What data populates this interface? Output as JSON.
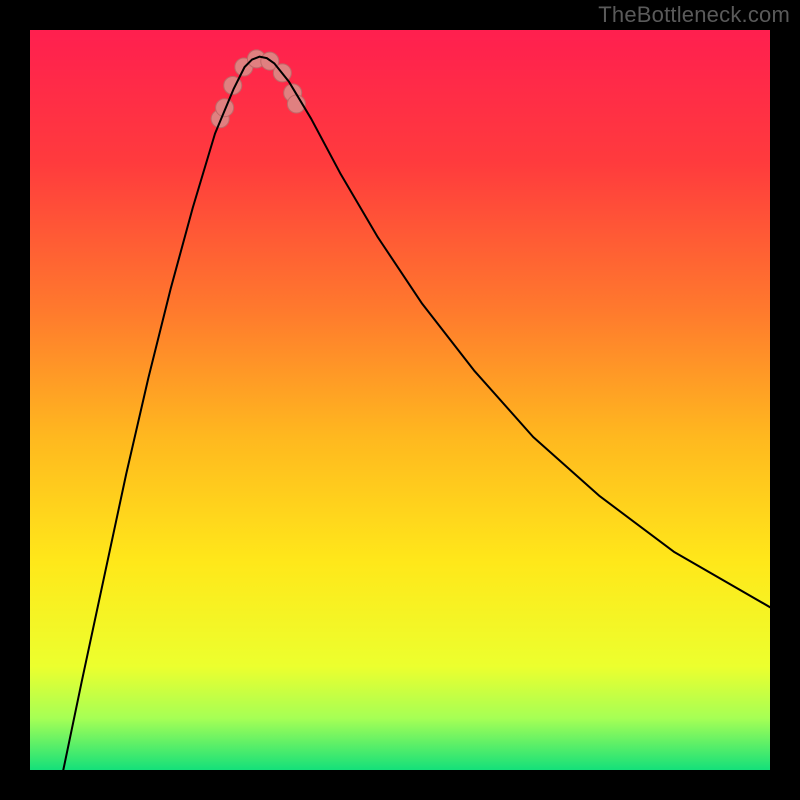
{
  "attribution": "TheBottleneck.com",
  "chart_data": {
    "type": "line",
    "title": "",
    "xlabel": "",
    "ylabel": "",
    "xlim": [
      0,
      100
    ],
    "ylim": [
      0,
      100
    ],
    "background_gradient_stops": [
      {
        "offset": 0,
        "color": "#ff1f4f"
      },
      {
        "offset": 18,
        "color": "#ff3b3d"
      },
      {
        "offset": 38,
        "color": "#ff7a2d"
      },
      {
        "offset": 55,
        "color": "#ffb81f"
      },
      {
        "offset": 72,
        "color": "#ffe81a"
      },
      {
        "offset": 86,
        "color": "#ecff2e"
      },
      {
        "offset": 93,
        "color": "#a6ff55"
      },
      {
        "offset": 100,
        "color": "#14e07a"
      }
    ],
    "green_band": {
      "y_top": 94,
      "y_bottom": 100
    },
    "yellow_band_top": 78,
    "series": [
      {
        "name": "bottleneck-curve",
        "stroke": "#000000",
        "stroke_width": 2,
        "x_min_y": 31,
        "points": [
          {
            "x": 4.5,
            "y": 0
          },
          {
            "x": 7,
            "y": 12
          },
          {
            "x": 10,
            "y": 26
          },
          {
            "x": 13,
            "y": 40
          },
          {
            "x": 16,
            "y": 53
          },
          {
            "x": 19,
            "y": 65
          },
          {
            "x": 22,
            "y": 76
          },
          {
            "x": 25,
            "y": 86
          },
          {
            "x": 27.5,
            "y": 92
          },
          {
            "x": 29,
            "y": 95
          },
          {
            "x": 30,
            "y": 96
          },
          {
            "x": 31,
            "y": 96.4
          },
          {
            "x": 32,
            "y": 96.2
          },
          {
            "x": 33,
            "y": 95.5
          },
          {
            "x": 35,
            "y": 93
          },
          {
            "x": 38,
            "y": 88
          },
          {
            "x": 42,
            "y": 80.5
          },
          {
            "x": 47,
            "y": 72
          },
          {
            "x": 53,
            "y": 63
          },
          {
            "x": 60,
            "y": 54
          },
          {
            "x": 68,
            "y": 45
          },
          {
            "x": 77,
            "y": 37
          },
          {
            "x": 87,
            "y": 29.5
          },
          {
            "x": 100,
            "y": 22
          }
        ]
      }
    ],
    "markers": {
      "name": "highlighted-range",
      "fill": "#e08080",
      "stroke": "#c06868",
      "radius_px": 9,
      "points": [
        {
          "x": 25.7,
          "y": 88
        },
        {
          "x": 26.3,
          "y": 89.5
        },
        {
          "x": 27.4,
          "y": 92.5
        },
        {
          "x": 28.9,
          "y": 95
        },
        {
          "x": 30.6,
          "y": 96.1
        },
        {
          "x": 32.4,
          "y": 95.8
        },
        {
          "x": 34.1,
          "y": 94.2
        },
        {
          "x": 35.5,
          "y": 91.5
        },
        {
          "x": 36.0,
          "y": 90
        }
      ]
    }
  }
}
